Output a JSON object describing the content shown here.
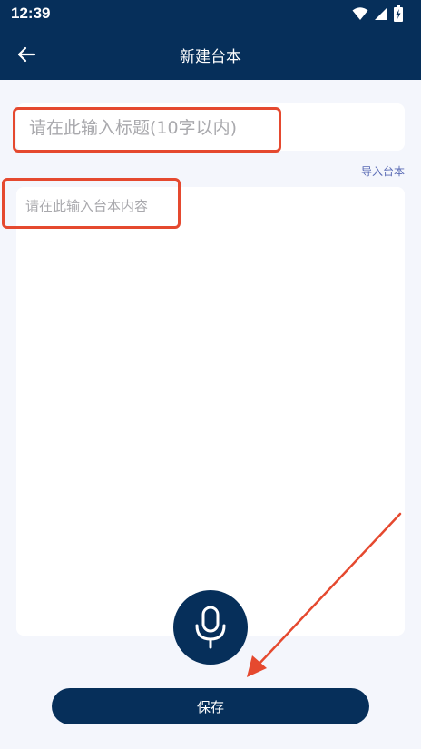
{
  "status_bar": {
    "time": "12:39",
    "icons": [
      "wifi-icon",
      "signal-icon",
      "battery-charging-icon"
    ]
  },
  "app_bar": {
    "back_icon": "arrow-left-icon",
    "title": "新建台本"
  },
  "form": {
    "title_placeholder": "请在此输入标题(10字以内)",
    "title_value": "",
    "import_link": "导入台本",
    "content_placeholder": "请在此输入台本内容",
    "content_value": ""
  },
  "mic_button": {
    "icon": "microphone-icon"
  },
  "save_button": {
    "label": "保存"
  },
  "colors": {
    "primary": "#062f5a",
    "background": "#f4f6fc",
    "highlight": "#e5492f",
    "link": "#5a6bb5"
  }
}
